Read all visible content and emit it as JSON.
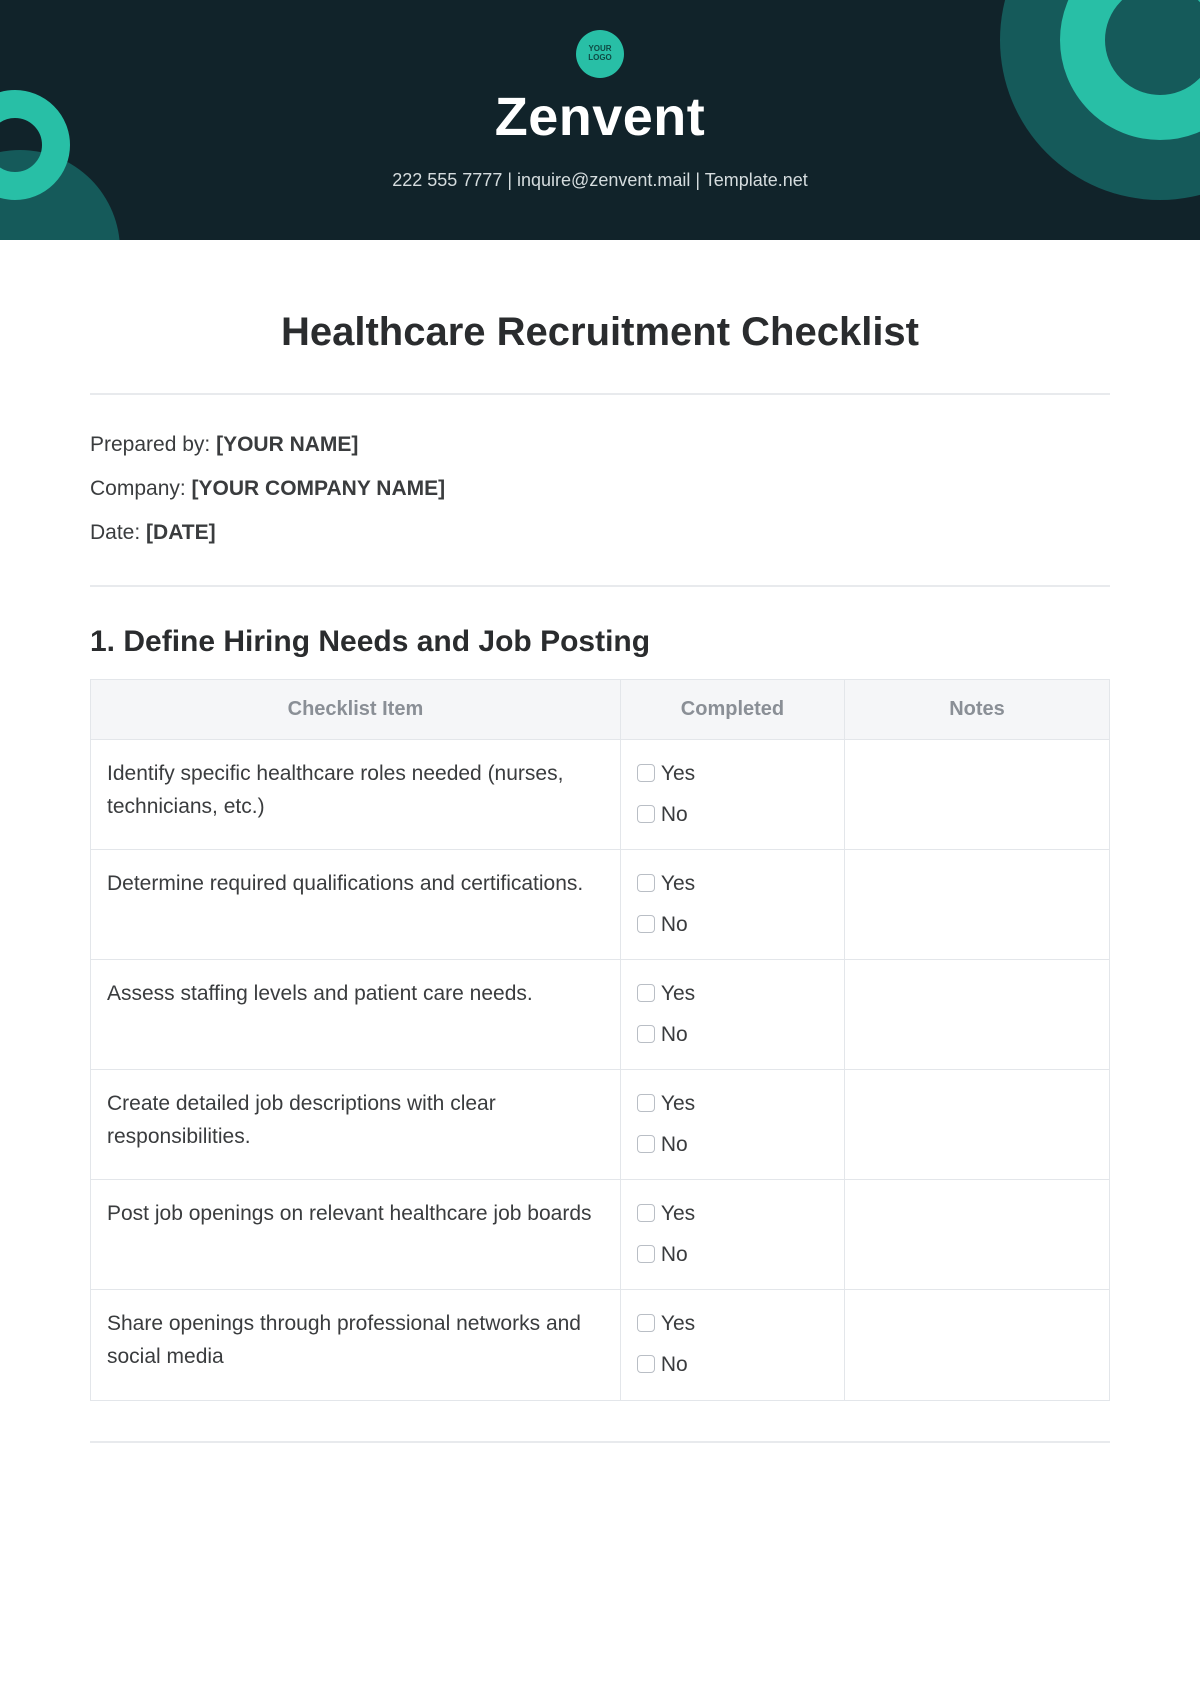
{
  "header": {
    "logo_text": "YOUR LOGO",
    "brand": "Zenvent",
    "contact": "222 555 7777  |  inquire@zenvent.mail |  Template.net"
  },
  "title": "Healthcare Recruitment Checklist",
  "meta": {
    "prepared_label": "Prepared by: ",
    "prepared_value": "[YOUR NAME]",
    "company_label": "Company: ",
    "company_value": "[YOUR COMPANY NAME]",
    "date_label": "Date: ",
    "date_value": "[DATE]"
  },
  "section": {
    "heading": "1. Define Hiring Needs and Job Posting",
    "columns": {
      "item": "Checklist Item",
      "completed": "Completed",
      "notes": "Notes"
    },
    "yes": "Yes",
    "no": "No",
    "rows": [
      {
        "item": "Identify specific healthcare roles needed (nurses, technicians, etc.)"
      },
      {
        "item": "Determine required qualifications and certifications."
      },
      {
        "item": "Assess staffing levels and patient care needs."
      },
      {
        "item": "Create detailed job descriptions with clear responsibilities."
      },
      {
        "item": "Post job openings on relevant healthcare job boards"
      },
      {
        "item": "Share openings through professional networks and social media"
      }
    ]
  }
}
